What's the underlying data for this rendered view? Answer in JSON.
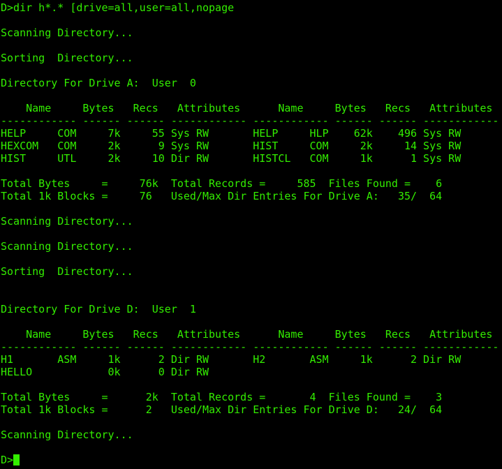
{
  "terminal": {
    "text_color": "#33ee00",
    "background_color": "#000000",
    "cursor_color": "#33ee00",
    "lines": [
      "D>dir h*.* [drive=all,user=all,nopage",
      "",
      "Scanning Directory...",
      "",
      "Sorting  Directory...",
      "",
      "Directory For Drive A:  User  0",
      "",
      "    Name     Bytes   Recs   Attributes      Name     Bytes   Recs   Attributes",
      "------------ ------ ------ ------------ ------------ ------ ------ ------------",
      "HELP     COM     7k     55 Sys RW       HELP     HLP    62k    496 Sys RW",
      "HEXCOM   COM     2k      9 Sys RW       HIST     COM     2k     14 Sys RW",
      "HIST     UTL     2k     10 Dir RW       HISTCL   COM     1k      1 Sys RW",
      "",
      "Total Bytes     =     76k  Total Records =     585  Files Found =    6",
      "Total 1k Blocks =     76   Used/Max Dir Entries For Drive A:   35/  64",
      "",
      "Scanning Directory...",
      "",
      "Scanning Directory...",
      "",
      "Sorting  Directory...",
      "",
      "",
      "Directory For Drive D:  User  1",
      "",
      "    Name     Bytes   Recs   Attributes      Name     Bytes   Recs   Attributes",
      "------------ ------ ------ ------------ ------------ ------ ------ ------------",
      "H1       ASM     1k      2 Dir RW       H2       ASM     1k      2 Dir RW",
      "HELLO            0k      0 Dir RW",
      "",
      "Total Bytes     =      2k  Total Records =       4  Files Found =    3",
      "Total 1k Blocks =      2   Used/Max Dir Entries For Drive D:   24/  64",
      "",
      "Scanning Directory...",
      ""
    ],
    "prompt": "D>"
  }
}
